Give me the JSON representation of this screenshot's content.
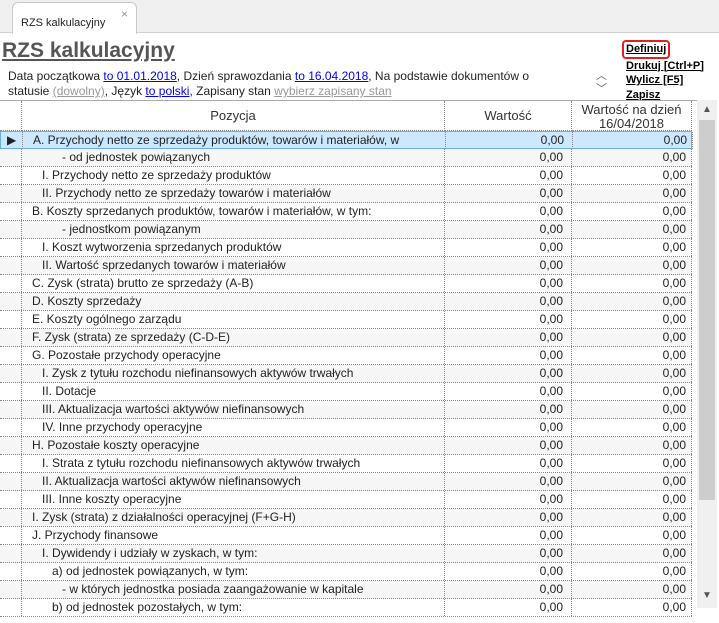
{
  "tab": {
    "label": "RZS kalkulacyjny",
    "close": "×"
  },
  "title": "RZS kalkulacyjny",
  "params": {
    "t1": "Data początkowa ",
    "l1": "to 01.01.2018",
    "t2": ", Dzień sprawozdania ",
    "l2": "to 16.04.2018",
    "t3": ", Na podstawie dokumentów o statusie ",
    "l3": "(dowolny)",
    "t4": ", Język ",
    "l4": "to polski",
    "t5": ", Zapisany stan ",
    "l5": "wybierz zapisany stan"
  },
  "actions": {
    "define": "Definiuj",
    "print": "Drukuj [Ctrl+P]",
    "calc": "Wylicz [F5]",
    "save": "Zapisz"
  },
  "columns": {
    "position": "Pozycja",
    "value": "Wartość",
    "value_date": "Wartość na dzień 16/04/2018"
  },
  "rows": [
    {
      "label": "A. Przychody netto ze sprzedaży produktów, towarów i materiałów, w",
      "indent": 0,
      "v1": "0,00",
      "v2": "0,00"
    },
    {
      "label": "- od jednostek powiązanych",
      "indent": 3,
      "v1": "0,00",
      "v2": "0,00"
    },
    {
      "label": "I. Przychody netto ze sprzedaży produktów",
      "indent": 1,
      "v1": "0,00",
      "v2": "0,00"
    },
    {
      "label": "II. Przychody netto ze sprzedaży towarów i materiałów",
      "indent": 1,
      "v1": "0,00",
      "v2": "0,00"
    },
    {
      "label": "B. Koszty sprzedanych produktów, towarów i materiałów, w tym:",
      "indent": 0,
      "v1": "0,00",
      "v2": "0,00"
    },
    {
      "label": "- jednostkom powiązanym",
      "indent": 3,
      "v1": "0,00",
      "v2": "0,00"
    },
    {
      "label": "I. Koszt wytworzenia sprzedanych produktów",
      "indent": 1,
      "v1": "0,00",
      "v2": "0,00"
    },
    {
      "label": "II. Wartość sprzedanych towarów i materiałów",
      "indent": 1,
      "v1": "0,00",
      "v2": "0,00"
    },
    {
      "label": "C. Zysk (strata) brutto ze sprzedaży (A-B)",
      "indent": 0,
      "v1": "0,00",
      "v2": "0,00"
    },
    {
      "label": "D. Koszty sprzedaży",
      "indent": 0,
      "v1": "0,00",
      "v2": "0,00"
    },
    {
      "label": "E. Koszty ogólnego zarządu",
      "indent": 0,
      "v1": "0,00",
      "v2": "0,00"
    },
    {
      "label": "F. Zysk (strata) ze sprzedaży (C-D-E)",
      "indent": 0,
      "v1": "0,00",
      "v2": "0,00"
    },
    {
      "label": "G. Pozostałe przychody operacyjne",
      "indent": 0,
      "v1": "0,00",
      "v2": "0,00"
    },
    {
      "label": "I. Zysk z tytułu rozchodu niefinansowych aktywów trwałych",
      "indent": 1,
      "v1": "0,00",
      "v2": "0,00"
    },
    {
      "label": "II. Dotacje",
      "indent": 1,
      "v1": "0,00",
      "v2": "0,00"
    },
    {
      "label": "III. Aktualizacja wartości aktywów niefinansowych",
      "indent": 1,
      "v1": "0,00",
      "v2": "0,00"
    },
    {
      "label": "IV. Inne przychody operacyjne",
      "indent": 1,
      "v1": "0,00",
      "v2": "0,00"
    },
    {
      "label": "H. Pozostałe koszty operacyjne",
      "indent": 0,
      "v1": "0,00",
      "v2": "0,00"
    },
    {
      "label": "I. Strata z tytułu rozchodu niefinansowych aktywów trwałych",
      "indent": 1,
      "v1": "0,00",
      "v2": "0,00"
    },
    {
      "label": "II. Aktualizacja wartości aktywów niefinansowych",
      "indent": 1,
      "v1": "0,00",
      "v2": "0,00"
    },
    {
      "label": "III. Inne koszty operacyjne",
      "indent": 1,
      "v1": "0,00",
      "v2": "0,00"
    },
    {
      "label": "I. Zysk (strata) z działalności operacyjnej (F+G-H)",
      "indent": 0,
      "v1": "0,00",
      "v2": "0,00"
    },
    {
      "label": "J. Przychody finansowe",
      "indent": 0,
      "v1": "0,00",
      "v2": "0,00"
    },
    {
      "label": "I. Dywidendy i udziały w zyskach, w tym:",
      "indent": 1,
      "v1": "0,00",
      "v2": "0,00"
    },
    {
      "label": "a) od jednostek powiązanych, w tym:",
      "indent": 2,
      "v1": "0,00",
      "v2": "0,00"
    },
    {
      "label": "- w których jednostka posiada zaangażowanie w kapitale",
      "indent": 3,
      "v1": "0,00",
      "v2": "0,00"
    },
    {
      "label": "b) od jednostek pozostałych, w tym:",
      "indent": 2,
      "v1": "0,00",
      "v2": "0,00"
    }
  ],
  "selected_row": 0,
  "colors": {
    "link": "#0000ee",
    "selection": "#cce8ff",
    "highlight": "#e02020"
  }
}
